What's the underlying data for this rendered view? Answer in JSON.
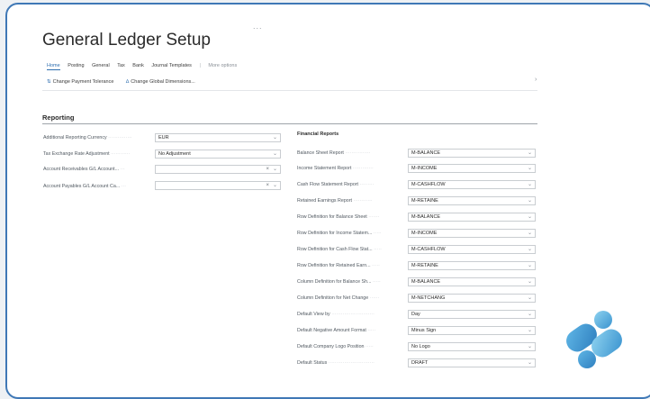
{
  "page": {
    "title": "General Ledger Setup",
    "dots": "..."
  },
  "tabs": [
    {
      "label": "Home"
    },
    {
      "label": "Posting"
    },
    {
      "label": "General"
    },
    {
      "label": "Tax"
    },
    {
      "label": "Bank"
    },
    {
      "label": "Journal Templates"
    },
    {
      "label": "More options"
    }
  ],
  "actions": [
    {
      "label": "Change Payment Tolerance"
    },
    {
      "label": "Change Global Dimensions..."
    }
  ],
  "reporting": {
    "title": "Reporting",
    "left_fields": [
      {
        "label": "Additional Reporting Currency",
        "value": "EUR"
      },
      {
        "label": "Tax Exchange Rate Adjustment",
        "value": "No Adjustment"
      },
      {
        "label": "Account Receivables G/L Account...",
        "value": ""
      },
      {
        "label": "Account Payables G/L Account Ca...",
        "value": ""
      }
    ],
    "financial_reports_title": "Financial Reports",
    "right_fields": [
      {
        "label": "Balance Sheet Report",
        "value": "M-BALANCE"
      },
      {
        "label": "Income Statement Report",
        "value": "M-INCOME"
      },
      {
        "label": "Cash Flow Statement Report",
        "value": "M-CASHFLOW"
      },
      {
        "label": "Retained Earnings Report",
        "value": "M-RETAINE"
      },
      {
        "label": "Row Definition for Balance Sheet",
        "value": "M-BALANCE"
      },
      {
        "label": "Row Definition for Income Statem...",
        "value": "M-INCOME"
      },
      {
        "label": "Row Definition for Cash Flow Stat...",
        "value": "M-CASHFLOW"
      },
      {
        "label": "Row Definition for Retained Earn...",
        "value": "M-RETAINE"
      },
      {
        "label": "Column Definition for Balance Sh...",
        "value": "M-BALANCE"
      },
      {
        "label": "Column Definition for Net Change",
        "value": "M-NETCHANG"
      },
      {
        "label": "Default View by",
        "value": "Day"
      },
      {
        "label": "Default Negative Amount Format",
        "value": "Minus Sign"
      },
      {
        "label": "Default Company Logo Position",
        "value": "No Logo"
      },
      {
        "label": "Default Status",
        "value": "DRAFT"
      }
    ]
  }
}
